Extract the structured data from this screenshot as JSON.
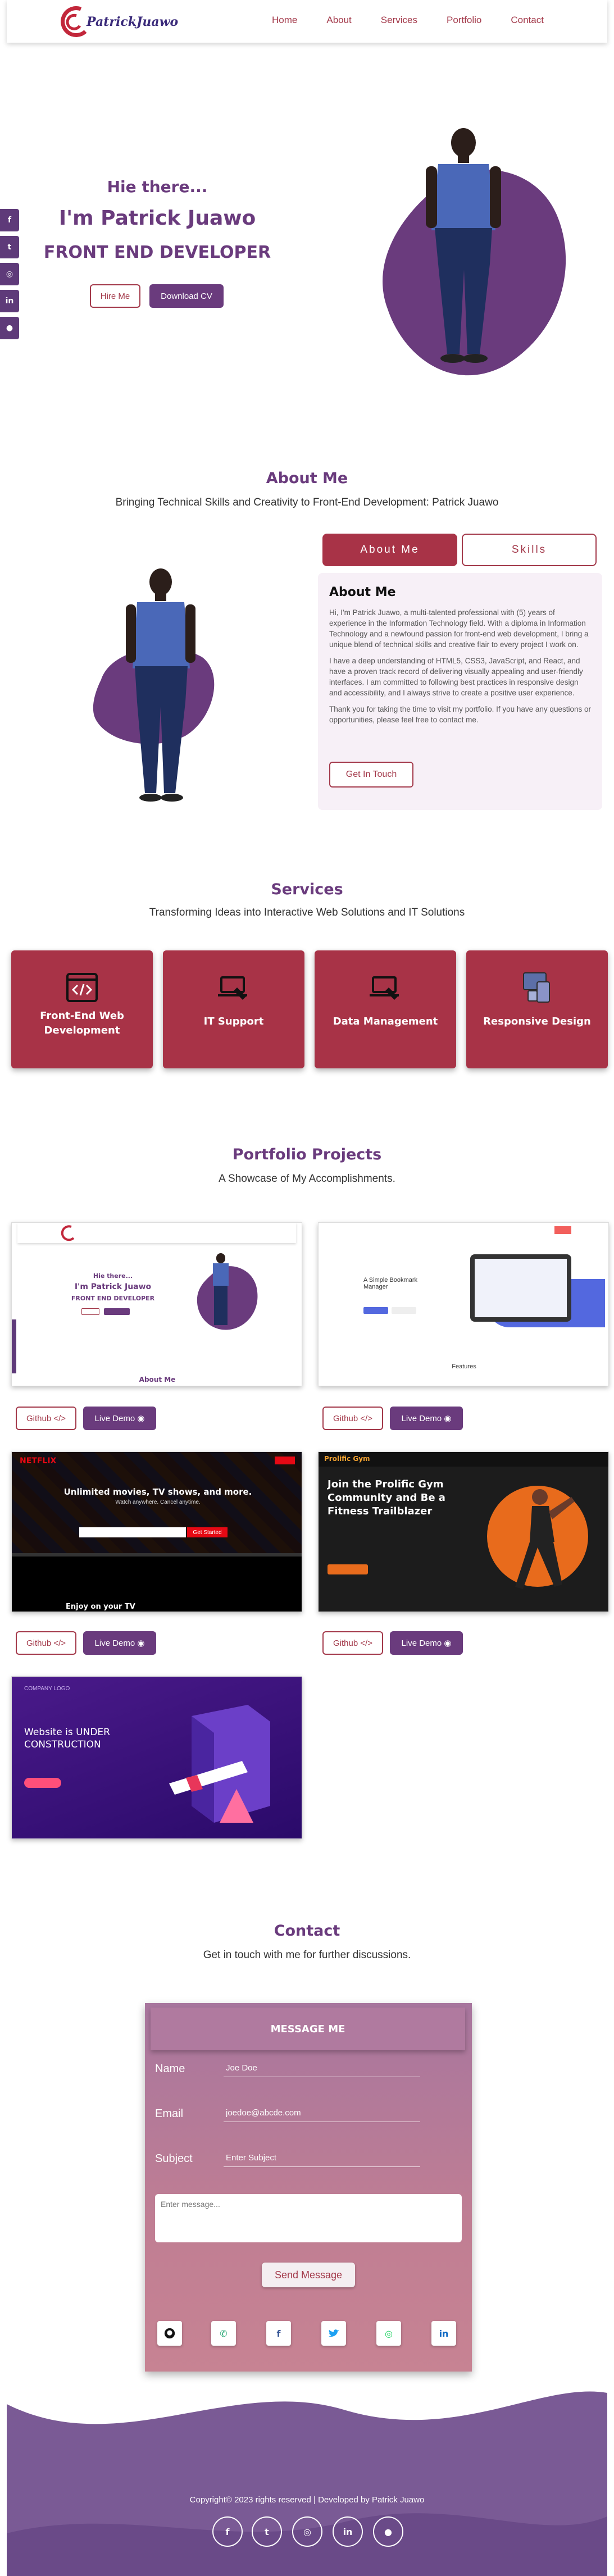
{
  "brand": {
    "name": "PatrickJuawo"
  },
  "nav": {
    "items": [
      "Home",
      "About",
      "Services",
      "Portfolio",
      "Contact"
    ]
  },
  "side_socials": [
    "facebook-icon",
    "twitter-icon",
    "whatsapp-icon",
    "linkedin-icon",
    "github-icon"
  ],
  "hero": {
    "greeting": "Hie there...",
    "name": "I'm Patrick Juawo",
    "role": "FRONT END DEVELOPER",
    "hire_label": "Hire Me",
    "download_label": "Download CV"
  },
  "about": {
    "title": "About Me",
    "subtitle": "Bringing Technical Skills and Creativity to Front-End Development: Patrick Juawo",
    "tabs": [
      "About Me",
      "Skills"
    ],
    "heading": "About Me",
    "paragraphs": [
      "Hi, I'm Patrick Juawo, a multi-talented professional with (5) years of experience in the Information Technology field. With a diploma in Information Technology and a newfound passion for front-end web development, I bring a unique blend of technical skills and creative flair to every project I work on.",
      "I have a deep understanding of HTML5, CSS3, JavaScript, and React, and have a proven track record of delivering visually appealing and user-friendly interfaces. I am committed to following best practices in responsive design and accessibility, and I always strive to create a positive user experience.",
      "Thank you for taking the time to visit my portfolio. If you have any questions or opportunities, please feel free to contact me."
    ],
    "cta_label": "Get In Touch"
  },
  "services": {
    "title": "Services",
    "subtitle": "Transforming Ideas into Interactive Web Solutions and IT Solutions",
    "items": [
      "Front-End Web Development",
      "IT Support",
      "Data Management",
      "Responsive Design"
    ]
  },
  "portfolio": {
    "title": "Portfolio Projects",
    "subtitle": "A Showcase of My Accomplishments.",
    "github_label": "Github </>",
    "demo_label": "Live Demo ◉",
    "projects": [
      {
        "thumb_title": "I'm Patrick Juawo",
        "thumb_sub": "FRONT END DEVELOPER",
        "thumb_greet": "Hie there...",
        "thumb_footer": "About Me"
      },
      {
        "thumb_title": "A Simple Bookmark Manager",
        "thumb_footer": "Features"
      },
      {
        "thumb_title": "Unlimited movies, TV shows, and more.",
        "thumb_sub": "Watch anywhere. Cancel anytime.",
        "thumb_cta": "Get Started",
        "thumb_brand": "NETFLIX",
        "thumb_footer": "Enjoy on your TV"
      },
      {
        "thumb_title": "Join the Prolific Gym Community and Be a Fitness Trailblazer",
        "thumb_brand": "Prolific Gym"
      },
      {
        "thumb_title": "Website is UNDER CONSTRUCTION",
        "thumb_brand": "COMPANY LOGO"
      }
    ]
  },
  "contact": {
    "title": "Contact",
    "subtitle": "Get in touch with me for further discussions.",
    "form_title": "MESSAGE ME",
    "name_label": "Name",
    "name_placeholder": "Joe Doe",
    "email_label": "Email",
    "email_placeholder": "joedoe@abcde.com",
    "subject_label": "Subject",
    "subject_placeholder": "Enter Subject",
    "message_placeholder": "Enter message...",
    "send_label": "Send Message",
    "socials": [
      "github-icon",
      "phone-icon",
      "facebook-icon",
      "twitter-icon",
      "whatsapp-icon",
      "linkedin-icon"
    ]
  },
  "footer": {
    "copyright": "Copyright© 2023 rights reserved | Developed by Patrick Juawo",
    "socials": [
      "facebook-icon",
      "twitter-icon",
      "whatsapp-icon",
      "linkedin-icon",
      "github-icon"
    ]
  },
  "colors": {
    "primary": "#6a3b7d",
    "accent": "#a83347",
    "blob": "#6a3b7d",
    "footer": "#7a5a95"
  }
}
